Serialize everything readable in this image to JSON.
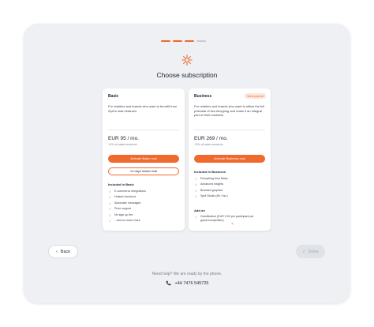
{
  "progress": {
    "total_steps": 4,
    "completed_steps": 3
  },
  "page_title": "Choose subscription",
  "plans": [
    {
      "name": "Basic",
      "badge": "",
      "description": "For retailers and brands who want to benefit from Sprii's main features",
      "price": "EUR 95 / mo.",
      "price_note": "+4% of sales revenue",
      "cta_label": "Activate Basic now",
      "trial_label": "14 days limited trial",
      "features_title": "Included in Basic",
      "features": [
        "E-commerce integrations",
        "Hosted checkout",
        "Automatic messages",
        "Price support",
        "No sign-up fee",
        "...and so much more"
      ]
    },
    {
      "name": "Business",
      "badge": "Most popular",
      "description": "For retailers and brands who want to utilize the full potential of live-shopping and make it an integral part of their business",
      "price": "EUR 269 / mo.",
      "price_note": "+3% of sales revenue",
      "cta_label": "Activate Business now",
      "features_title": "Included in Business",
      "features": [
        "Everything from Basic",
        "Advanced insights",
        "Branded graphics",
        "Sprii Studio (8h / mo.)"
      ],
      "addon_title": "Add on",
      "addon_text": "Gamification (EUR 0.03 per participant per game/competition)"
    }
  ],
  "footer": {
    "back_label": "Back",
    "done_label": "Done",
    "help_text": "Need help? We are ready by the phone.",
    "phone": "+44 7476 545725"
  },
  "colors": {
    "accent": "#ef6a2c",
    "background": "#eef0f4",
    "card": "#ffffff"
  }
}
